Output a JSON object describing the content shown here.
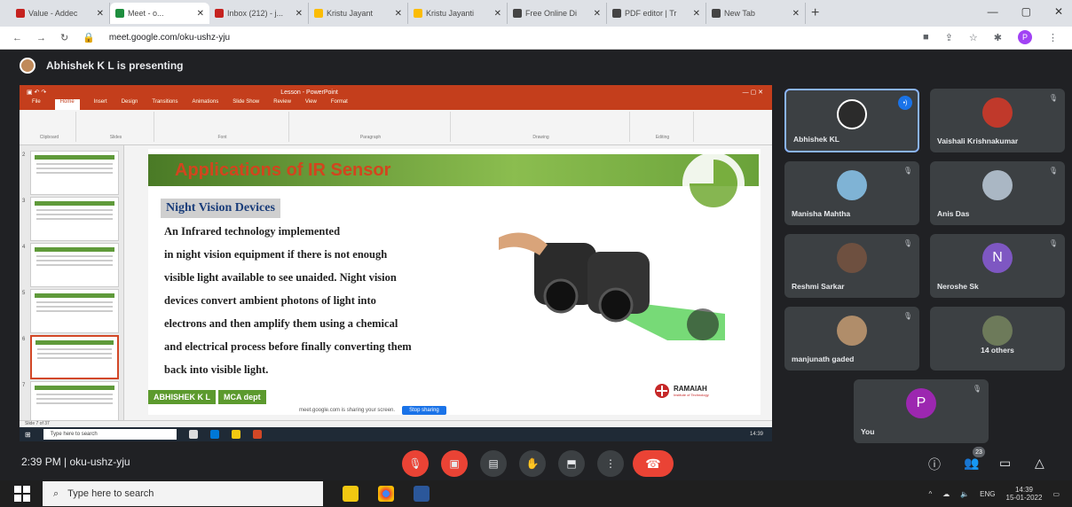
{
  "browser": {
    "tabs": [
      {
        "label": "Value - Addec",
        "color": "#c5221f"
      },
      {
        "label": "Meet - o...",
        "color": "#1e8e3e",
        "active": true
      },
      {
        "label": "Inbox (212) - j...",
        "color": "#c5221f"
      },
      {
        "label": "Kristu Jayant",
        "color": "#fbbc04"
      },
      {
        "label": "Kristu Jayanti",
        "color": "#fbbc04"
      },
      {
        "label": "Free Online Di",
        "color": "#444"
      },
      {
        "label": "PDF editor | Tr",
        "color": "#444"
      },
      {
        "label": "New Tab",
        "color": "#444"
      }
    ],
    "new_tab": "+",
    "url": "meet.google.com/oku-ushz-yju",
    "profile": "P"
  },
  "meet": {
    "presenter_label": "Abhishek K L is presenting",
    "meeting_time": "2:39 PM",
    "meeting_code": "oku-ushz-yju",
    "participants_count": "23",
    "participants": [
      {
        "name": "Abhishek KL",
        "color": "#2b2b2b"
      },
      {
        "name": "Vaishali Krishnakumar",
        "color": "#c0392b"
      },
      {
        "name": "Manisha Mahtha",
        "color": "#7fb3d5"
      },
      {
        "name": "Anis Das",
        "color": "#aab7c4"
      },
      {
        "name": "Reshmi Sarkar",
        "color": "#6e5040"
      },
      {
        "name": "Neroshe Sk",
        "initial": "N",
        "color": "#7e57c2"
      },
      {
        "name": "manjunath gaded",
        "color": "#b08d6a"
      },
      {
        "name": "14 others",
        "color": "#6d7a5a"
      },
      {
        "name": "You",
        "initial": "P",
        "color": "#9c27b0"
      }
    ]
  },
  "ppt": {
    "title_bar": "Lesson - PowerPoint",
    "tabs": [
      "File",
      "Home",
      "Insert",
      "Design",
      "Transitions",
      "Animations",
      "Slide Show",
      "Review",
      "View",
      "Format"
    ],
    "slide": {
      "title": "Applications of IR Sensor",
      "subheading": "Night Vision Devices",
      "lines": [
        "An Infrared technology implemented",
        "in night vision equipment if there is not enough",
        "visible light available to see unaided. Night vision",
        "devices convert ambient photons of light into",
        "electrons and then amplify them using a chemical",
        "and electrical process before finally converting them",
        "back into visible light."
      ],
      "footer_name": "ABHISHEK K L",
      "footer_dept": "MCA dept",
      "logo_name": "RAMAIAH",
      "logo_sub": "Institute of Technology"
    },
    "share_tip": "meet.google.com is sharing your screen.",
    "share_button": "Stop sharing",
    "status": "Slide 7 of 37",
    "inner_search": "Type here to search"
  },
  "taskbar": {
    "search_placeholder": "Type here to search",
    "lang": "ENG",
    "time": "14:39",
    "date": "15-01-2022"
  }
}
